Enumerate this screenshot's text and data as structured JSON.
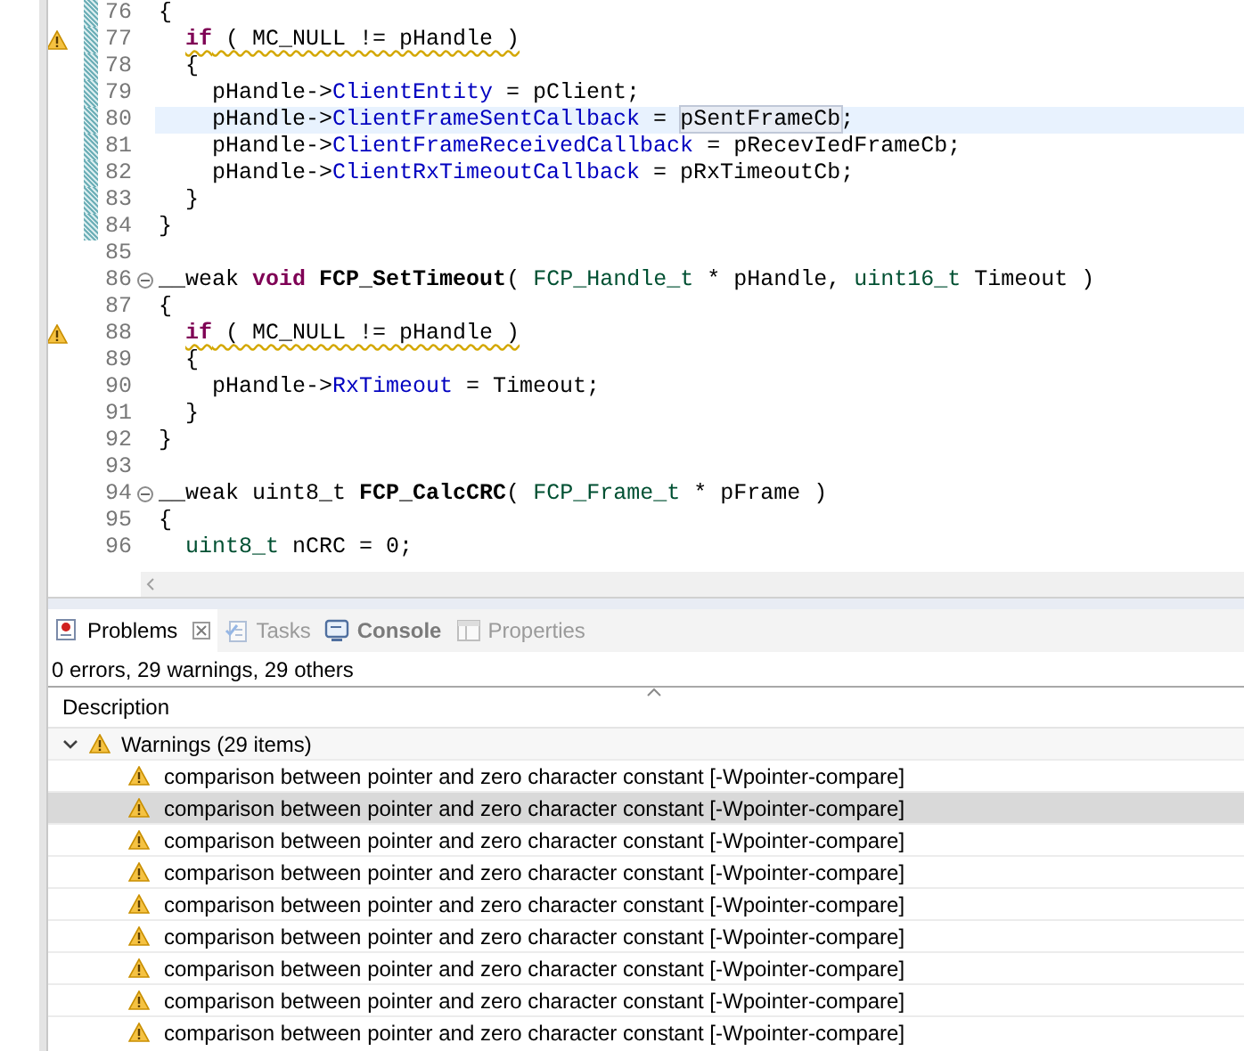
{
  "editor": {
    "lines": [
      {
        "number": "76",
        "indented": false,
        "changed": true,
        "warning": false,
        "current": false,
        "fold": false,
        "segments": [
          {
            "kind": "plain",
            "text": "{"
          }
        ]
      },
      {
        "number": "77",
        "indented": true,
        "changed": true,
        "warning": true,
        "current": false,
        "fold": false,
        "segments": [
          {
            "kind": "squiggle",
            "children": [
              {
                "kind": "keyword",
                "text": "if"
              },
              {
                "kind": "plain",
                "text": " ( MC_NULL != pHandle )"
              }
            ]
          }
        ]
      },
      {
        "number": "78",
        "indented": true,
        "changed": true,
        "warning": false,
        "current": false,
        "fold": false,
        "segments": [
          {
            "kind": "plain",
            "text": "{"
          }
        ]
      },
      {
        "number": "79",
        "indented": true,
        "changed": true,
        "warning": false,
        "current": false,
        "fold": false,
        "segments": [
          {
            "kind": "plain",
            "text": "  pHandle->"
          },
          {
            "kind": "field",
            "text": "ClientEntity"
          },
          {
            "kind": "plain",
            "text": " = pClient;"
          }
        ]
      },
      {
        "number": "80",
        "indented": true,
        "changed": true,
        "warning": false,
        "current": true,
        "fold": false,
        "segments": [
          {
            "kind": "plain",
            "text": "  pHandle->"
          },
          {
            "kind": "field",
            "text": "ClientFrameSentCallback"
          },
          {
            "kind": "plain",
            "text": " = "
          },
          {
            "kind": "occurrence",
            "text": "pSentFrameCb"
          },
          {
            "kind": "plain",
            "text": ";"
          }
        ]
      },
      {
        "number": "81",
        "indented": true,
        "changed": true,
        "warning": false,
        "current": false,
        "fold": false,
        "segments": [
          {
            "kind": "plain",
            "text": "  pHandle->"
          },
          {
            "kind": "field",
            "text": "ClientFrameReceivedCallback"
          },
          {
            "kind": "plain",
            "text": " = pRecevIedFrameCb;"
          }
        ]
      },
      {
        "number": "82",
        "indented": true,
        "changed": true,
        "warning": false,
        "current": false,
        "fold": false,
        "segments": [
          {
            "kind": "plain",
            "text": "  pHandle->"
          },
          {
            "kind": "field",
            "text": "ClientRxTimeoutCallback"
          },
          {
            "kind": "plain",
            "text": " = pRxTimeoutCb;"
          }
        ]
      },
      {
        "number": "83",
        "indented": true,
        "changed": true,
        "warning": false,
        "current": false,
        "fold": false,
        "segments": [
          {
            "kind": "plain",
            "text": "}"
          }
        ]
      },
      {
        "number": "84",
        "indented": false,
        "changed": true,
        "warning": false,
        "current": false,
        "fold": false,
        "segments": [
          {
            "kind": "plain",
            "text": "}"
          }
        ]
      },
      {
        "number": "85",
        "changed": false,
        "warning": false,
        "current": false,
        "fold": false
      },
      {
        "number": "86",
        "indented": false,
        "changed": false,
        "warning": false,
        "current": false,
        "fold": true,
        "segments": [
          {
            "kind": "plain",
            "text": "__weak "
          },
          {
            "kind": "keyword",
            "text": "void"
          },
          {
            "kind": "function",
            "text": " FCP_SetTimeout"
          },
          {
            "kind": "plain",
            "text": "( "
          },
          {
            "kind": "type",
            "text": "FCP_Handle_t"
          },
          {
            "kind": "plain",
            "text": " * pHandle, "
          },
          {
            "kind": "type",
            "text": "uint16_t"
          },
          {
            "kind": "plain",
            "text": " Timeout )"
          }
        ]
      },
      {
        "number": "87",
        "indented": false,
        "changed": false,
        "warning": false,
        "current": false,
        "fold": false,
        "segments": [
          {
            "kind": "plain",
            "text": "{"
          }
        ]
      },
      {
        "number": "88",
        "indented": true,
        "changed": false,
        "warning": true,
        "current": false,
        "fold": false,
        "segments": [
          {
            "kind": "squiggle",
            "children": [
              {
                "kind": "keyword",
                "text": "if"
              },
              {
                "kind": "plain",
                "text": " ( MC_NULL != pHandle )"
              }
            ]
          }
        ]
      },
      {
        "number": "89",
        "indented": true,
        "changed": false,
        "warning": false,
        "current": false,
        "fold": false,
        "segments": [
          {
            "kind": "plain",
            "text": "{"
          }
        ]
      },
      {
        "number": "90",
        "indented": true,
        "changed": false,
        "warning": false,
        "current": false,
        "fold": false,
        "segments": [
          {
            "kind": "plain",
            "text": "  pHandle->"
          },
          {
            "kind": "field",
            "text": "RxTimeout"
          },
          {
            "kind": "plain",
            "text": " = Timeout;"
          }
        ]
      },
      {
        "number": "91",
        "indented": true,
        "changed": false,
        "warning": false,
        "current": false,
        "fold": false,
        "segments": [
          {
            "kind": "plain",
            "text": "}"
          }
        ]
      },
      {
        "number": "92",
        "indented": false,
        "changed": false,
        "warning": false,
        "current": false,
        "fold": false,
        "segments": [
          {
            "kind": "plain",
            "text": "}"
          }
        ]
      },
      {
        "number": "93",
        "changed": false,
        "warning": false,
        "current": false,
        "fold": false
      },
      {
        "number": "94",
        "indented": false,
        "changed": false,
        "warning": false,
        "current": false,
        "fold": true,
        "segments": [
          {
            "kind": "plain",
            "text": "__weak uint8_t "
          },
          {
            "kind": "function",
            "text": "FCP_CalcCRC"
          },
          {
            "kind": "plain",
            "text": "( "
          },
          {
            "kind": "type",
            "text": "FCP_Frame_t"
          },
          {
            "kind": "plain",
            "text": " * pFrame )"
          }
        ]
      },
      {
        "number": "95",
        "indented": false,
        "changed": false,
        "warning": false,
        "current": false,
        "fold": false,
        "segments": [
          {
            "kind": "plain",
            "text": "{"
          }
        ]
      },
      {
        "number": "96",
        "indented": true,
        "changed": false,
        "warning": false,
        "current": false,
        "fold": false,
        "segments": [
          {
            "kind": "type",
            "text": "uint8_t"
          },
          {
            "kind": "plain",
            "text": " nCRC = 0;"
          }
        ]
      }
    ]
  },
  "panel": {
    "tabs": [
      {
        "label": "Problems",
        "kind": "problems",
        "selected": true
      },
      {
        "label": "Tasks",
        "kind": "tasks",
        "selected": false
      },
      {
        "label": "Console",
        "kind": "console",
        "selected": false
      },
      {
        "label": "Properties",
        "kind": "properties",
        "selected": false
      }
    ],
    "summary": "0 errors, 29 warnings, 29 others",
    "column": "Description",
    "groups": [
      {
        "label": "Warnings (29 items)",
        "expanded": true,
        "items": [
          {
            "text": "comparison between pointer and zero character constant [-Wpointer-compare]",
            "selected": false
          },
          {
            "text": "comparison between pointer and zero character constant [-Wpointer-compare]",
            "selected": true
          },
          {
            "text": "comparison between pointer and zero character constant [-Wpointer-compare]",
            "selected": false
          },
          {
            "text": "comparison between pointer and zero character constant [-Wpointer-compare]",
            "selected": false
          },
          {
            "text": "comparison between pointer and zero character constant [-Wpointer-compare]",
            "selected": false
          },
          {
            "text": "comparison between pointer and zero character constant [-Wpointer-compare]",
            "selected": false
          },
          {
            "text": "comparison between pointer and zero character constant [-Wpointer-compare]",
            "selected": false
          },
          {
            "text": "comparison between pointer and zero character constant [-Wpointer-compare]",
            "selected": false
          },
          {
            "text": "comparison between pointer and zero character constant [-Wpointer-compare]",
            "selected": false
          }
        ]
      }
    ]
  }
}
